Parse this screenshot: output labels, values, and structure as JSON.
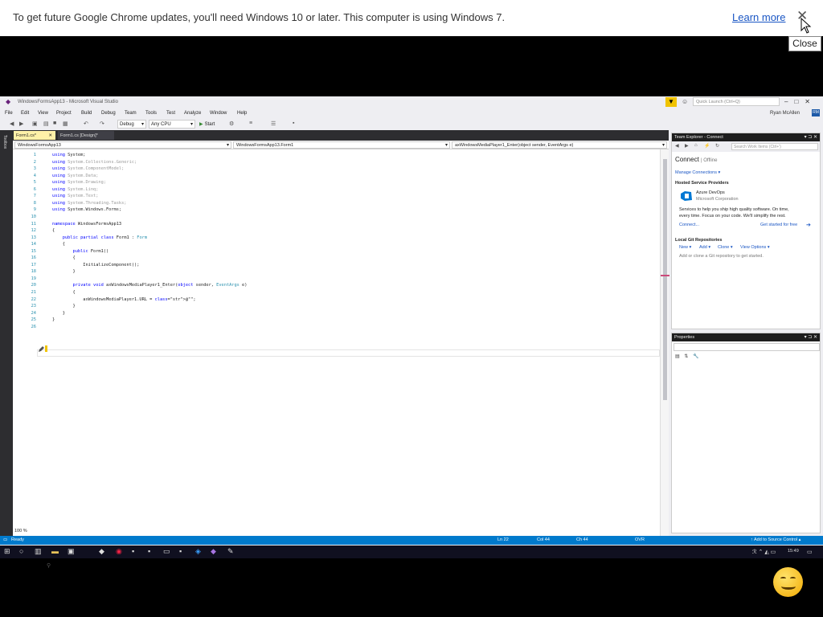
{
  "infobar": {
    "message": "To get future Google Chrome updates, you'll need Windows 10 or later. This computer is using Windows 7.",
    "learn_more": "Learn more",
    "close_glyph": "✕",
    "tooltip": "Close"
  },
  "vs": {
    "title": "WindowsFormsApp13 - Microsoft Visual Studio",
    "quick_launch_placeholder": "Quick Launch (Ctrl+Q)",
    "menu": [
      "File",
      "Edit",
      "View",
      "Project",
      "Build",
      "Debug",
      "Team",
      "Tools",
      "Test",
      "Analyze",
      "Window",
      "Help"
    ],
    "user": "Ryan McAllen",
    "avatar": "RM",
    "config": "Debug",
    "platform": "Any CPU",
    "start": "Start",
    "toolbox": "Toolbox",
    "tabs": [
      {
        "label": "Form1.cs*",
        "close": "✕"
      },
      {
        "label": "Form1.cs [Design]*"
      }
    ],
    "nav": {
      "project": "WindowsFormsApp13",
      "class": "WindowsFormsApp13.Form1",
      "member": "axWindowsMediaPlayer1_Enter(object sender, EventArgs e)"
    },
    "zoom": "100 %",
    "code_lines": [
      {
        "n": "1",
        "t": "using System;"
      },
      {
        "n": "2",
        "t": "using System.Collections.Generic;"
      },
      {
        "n": "3",
        "t": "using System.ComponentModel;"
      },
      {
        "n": "4",
        "t": "using System.Data;"
      },
      {
        "n": "5",
        "t": "using System.Drawing;"
      },
      {
        "n": "6",
        "t": "using System.Linq;"
      },
      {
        "n": "7",
        "t": "using System.Text;"
      },
      {
        "n": "8",
        "t": "using System.Threading.Tasks;"
      },
      {
        "n": "9",
        "t": "using System.Windows.Forms;"
      },
      {
        "n": "10",
        "t": ""
      },
      {
        "n": "11",
        "t": "namespace WindowsFormsApp13"
      },
      {
        "n": "12",
        "t": "{"
      },
      {
        "n": "13",
        "t": "    public partial class Form1 : Form"
      },
      {
        "n": "14",
        "t": "    {"
      },
      {
        "n": "15",
        "t": "        public Form1()"
      },
      {
        "n": "16",
        "t": "        {"
      },
      {
        "n": "17",
        "t": "            InitializeComponent();"
      },
      {
        "n": "18",
        "t": "        }"
      },
      {
        "n": "19",
        "t": ""
      },
      {
        "n": "20",
        "t": "        private void axWindowsMediaPlayer1_Enter(object sender, EventArgs e)"
      },
      {
        "n": "21",
        "t": "        {"
      },
      {
        "n": "22",
        "t": "            axWindowsMediaPlayer1.URL = @\"\";"
      },
      {
        "n": "23",
        "t": "        }"
      },
      {
        "n": "24",
        "t": "    }"
      },
      {
        "n": "25",
        "t": "}"
      },
      {
        "n": "26",
        "t": ""
      }
    ],
    "team_explorer": {
      "header": "Team Explorer - Connect",
      "search_placeholder": "Search Work Items (Ctrl+')",
      "connect": "Connect",
      "offline": "| Offline",
      "manage": "Manage Connections ▾",
      "hosted": "Hosted Service Providers",
      "azure": "Azure DevOps",
      "ms": "Microsoft Corporation",
      "desc1": "Services to help you ship high quality software. On time,",
      "desc2": "every time. Focus on your code. We'll simplify the rest.",
      "connect_link": "Connect...",
      "get_started": "Get started for free",
      "local": "Local Git Repositories",
      "new": "New ▾",
      "add": "Add ▾",
      "clone": "Clone ▾",
      "view_options": "View Options ▾",
      "add_hint": "Add or clone a Git repository to get started."
    },
    "properties": "Properties",
    "status": {
      "ready": "Ready",
      "ln": "Ln 22",
      "col": "Col 44",
      "ch": "Ch 44",
      "ovr": "OVR",
      "source": "↑ Add to Source Control ▴"
    }
  },
  "taskbar": {
    "time": "15:49"
  }
}
